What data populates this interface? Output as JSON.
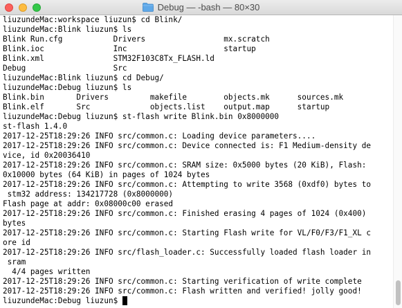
{
  "window": {
    "title": "Debug — -bash — 80×30"
  },
  "icons": {
    "title_folder": "folder-icon"
  },
  "colors": {
    "close": "#fc605c",
    "minimize": "#fdbc40",
    "zoom": "#34c84a",
    "folder": "#5fa8e8"
  },
  "terminal": {
    "lines": [
      "liuzundeMac:workspace liuzun$ cd Blink/",
      "liuzundeMac:Blink liuzun$ ls",
      "Blink Run.cfg           Drivers                 mx.scratch",
      "Blink.ioc               Inc                     startup",
      "Blink.xml               STM32F103C8Tx_FLASH.ld",
      "Debug                   Src",
      "liuzundeMac:Blink liuzun$ cd Debug/",
      "liuzundeMac:Debug liuzun$ ls",
      "Blink.bin       Drivers         makefile        objects.mk      sources.mk",
      "Blink.elf       Src             objects.list    output.map      startup",
      "liuzundeMac:Debug liuzun$ st-flash write Blink.bin 0x8000000",
      "st-flash 1.4.0",
      "2017-12-25T18:29:26 INFO src/common.c: Loading device parameters....",
      "2017-12-25T18:29:26 INFO src/common.c: Device connected is: F1 Medium-density de",
      "vice, id 0x20036410",
      "2017-12-25T18:29:26 INFO src/common.c: SRAM size: 0x5000 bytes (20 KiB), Flash:",
      "0x10000 bytes (64 KiB) in pages of 1024 bytes",
      "2017-12-25T18:29:26 INFO src/common.c: Attempting to write 3568 (0xdf0) bytes to",
      " stm32 address: 134217728 (0x8000000)",
      "Flash page at addr: 0x08000c00 erased",
      "2017-12-25T18:29:26 INFO src/common.c: Finished erasing 4 pages of 1024 (0x400)",
      "bytes",
      "2017-12-25T18:29:26 INFO src/common.c: Starting Flash write for VL/F0/F3/F1_XL c",
      "ore id",
      "2017-12-25T18:29:26 INFO src/flash_loader.c: Successfully loaded flash loader in",
      " sram",
      "  4/4 pages written",
      "2017-12-25T18:29:26 INFO src/common.c: Starting verification of write complete",
      "2017-12-25T18:29:26 INFO src/common.c: Flash written and verified! jolly good!"
    ],
    "prompt": "liuzundeMac:Debug liuzun$ "
  }
}
